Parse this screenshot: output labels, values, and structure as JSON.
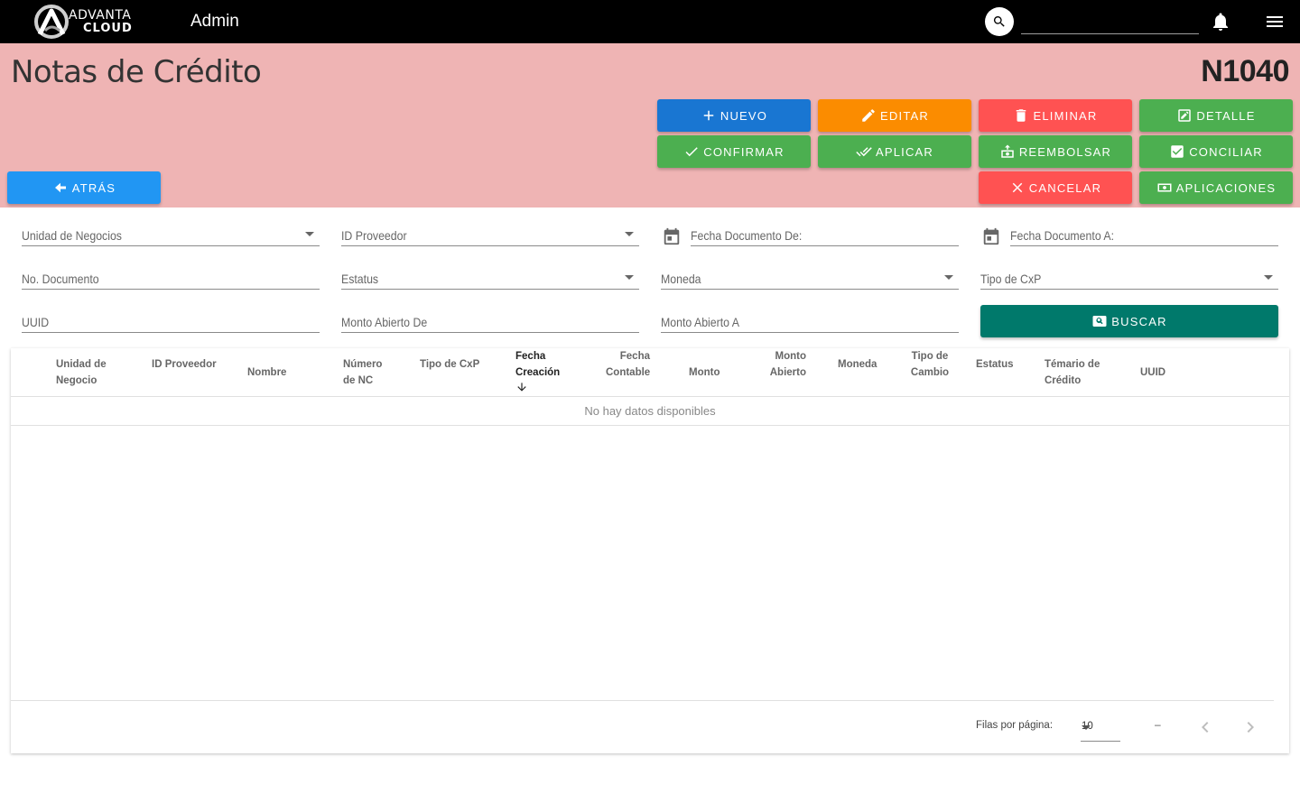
{
  "topbar": {
    "logo_line1": "ADVANTA",
    "logo_line2": "CLOUD",
    "app_title": "Admin",
    "search_value": ""
  },
  "header": {
    "title": "Notas de Crédito",
    "doc_code": "N1040"
  },
  "actions": {
    "nuevo": "NUEVO",
    "editar": "EDITAR",
    "eliminar": "ELIMINAR",
    "detalle": "DETALLE",
    "confirmar": "CONFIRMAR",
    "aplicar": "APLICAR",
    "reembolsar": "REEMBOLSAR",
    "conciliar": "CONCILIAR",
    "cancelar": "CANCELAR",
    "aplicaciones": "APLICACIONES",
    "atras": "ATRÁS",
    "buscar": "BUSCAR"
  },
  "filters": {
    "unidad_negocios": "Unidad de Negocios",
    "id_proveedor": "ID Proveedor",
    "fecha_doc_de": "Fecha Documento De:",
    "fecha_doc_a": "Fecha Documento A:",
    "no_documento": "No. Documento",
    "estatus": "Estatus",
    "moneda": "Moneda",
    "tipo_cxp": "Tipo de CxP",
    "uuid": "UUID",
    "monto_abierto_de": "Monto Abierto De",
    "monto_abierto_a": "Monto Abierto A"
  },
  "table": {
    "columns": [
      [
        "Unidad de",
        "Negocio"
      ],
      [
        "ID Proveedor"
      ],
      [
        "Nombre"
      ],
      [
        "Número",
        "de NC"
      ],
      [
        "Tipo de CxP"
      ],
      [
        "Fecha",
        "Creación"
      ],
      [
        "Fecha",
        "Contable"
      ],
      [
        "Monto"
      ],
      [
        "Monto",
        "Abierto"
      ],
      [
        "Moneda"
      ],
      [
        "Tipo de",
        "Cambio"
      ],
      [
        "Estatus"
      ],
      [
        "Témario de",
        "Crédito"
      ],
      [
        "UUID"
      ]
    ],
    "empty_text": "No hay datos disponibles",
    "rows_per_page_label": "Filas por página:",
    "rows_per_page_value": "10",
    "range_text": "–"
  }
}
